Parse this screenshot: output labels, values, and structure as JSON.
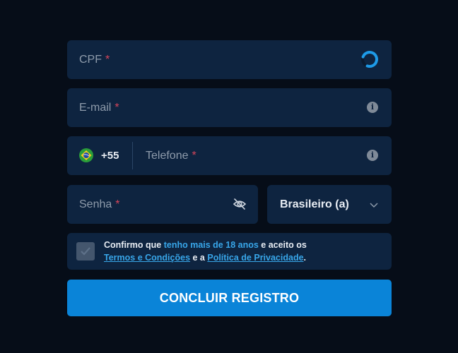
{
  "fields": {
    "cpf": {
      "label": "CPF",
      "required_mark": "*",
      "status_icon": "loading-spinner-icon"
    },
    "email": {
      "label": "E-mail",
      "required_mark": "*",
      "icon": "info-icon"
    },
    "phone": {
      "country_flag": "brazil-flag-icon",
      "dial_code": "+55",
      "label": "Telefone",
      "required_mark": "*",
      "icon": "info-icon"
    },
    "password": {
      "label": "Senha",
      "required_mark": "*",
      "icon": "eye-off-icon"
    },
    "language": {
      "selected": "Brasileiro (a)",
      "icon": "chevron-down-icon"
    }
  },
  "terms": {
    "text_1": "Confirmo que ",
    "highlight": "tenho mais de 18 anos",
    "text_2": " e aceito os",
    "link_terms": "Termos e Condições",
    "text_3": " e a ",
    "link_privacy": "Política de Privacidade",
    "text_4": "."
  },
  "submit_label": "CONCLUIR REGISTRO",
  "colors": {
    "background": "#060d18",
    "field_bg": "#0e2440",
    "accent": "#0a84d8",
    "link": "#38a6e9",
    "required": "#d6455a"
  }
}
